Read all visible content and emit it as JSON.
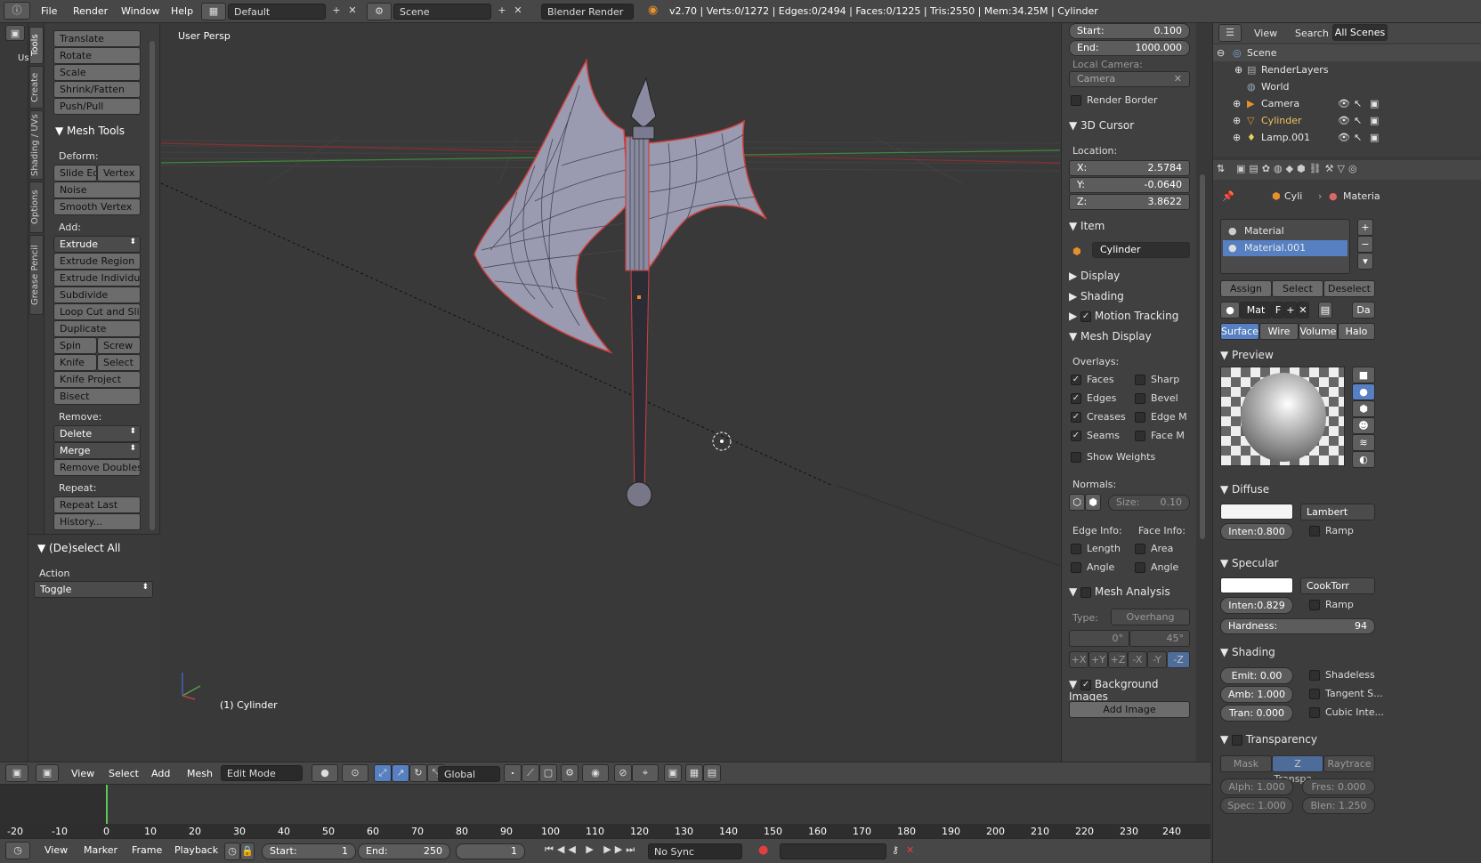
{
  "topbar": {
    "menus": [
      "File",
      "Render",
      "Window",
      "Help"
    ],
    "screen_layout": "Default",
    "scene": "Scene",
    "render_engine": "Blender Render",
    "stats": "v2.70 | Verts:0/1272 | Edges:0/2494 | Faces:0/1225 | Tris:2550 | Mem:34.25M | Cylinder"
  },
  "left_tabs": [
    "Tools",
    "Create",
    "Shading / UVs",
    "Options",
    "Grease Pencil"
  ],
  "toolshelf": {
    "transform_buttons": [
      "Translate",
      "Rotate",
      "Scale",
      "Shrink/Fatten",
      "Push/Pull"
    ],
    "mesh_tools_title": "Mesh Tools",
    "deform_label": "Deform:",
    "slide_edge": "Slide Ed",
    "vertex": "Vertex",
    "noise": "Noise",
    "smooth_vertex": "Smooth Vertex",
    "add_label": "Add:",
    "extrude": "Extrude",
    "extrude_region": "Extrude Region",
    "extrude_individual": "Extrude Individual",
    "subdivide": "Subdivide",
    "loop_cut": "Loop Cut and Slide",
    "duplicate": "Duplicate",
    "spin": "Spin",
    "screw": "Screw",
    "knife": "Knife",
    "select": "Select",
    "knife_project": "Knife Project",
    "bisect": "Bisect",
    "remove_label": "Remove:",
    "delete": "Delete",
    "merge": "Merge",
    "remove_doubles": "Remove Doubles",
    "repeat_label": "Repeat:",
    "repeat_last": "Repeat Last",
    "history": "History...",
    "deselect_title": "(De)select All",
    "action_label": "Action",
    "action_value": "Toggle"
  },
  "viewport": {
    "view_name": "User Persp",
    "object_label": "(1) Cylinder"
  },
  "npanel": {
    "start_label": "Start:",
    "start_value": "0.100",
    "end_label": "End:",
    "end_value": "1000.000",
    "local_camera": "Local Camera:",
    "camera": "Camera",
    "render_border": "Render Border",
    "cursor_title": "3D Cursor",
    "location": "Location:",
    "x_label": "X:",
    "x_value": "2.5784",
    "y_label": "Y:",
    "y_value": "-0.0640",
    "z_label": "Z:",
    "z_value": "3.8622",
    "item_title": "Item",
    "item_name": "Cylinder",
    "display": "Display",
    "shading": "Shading",
    "motion_tracking": "Motion Tracking",
    "mesh_display": "Mesh Display",
    "overlays": "Overlays:",
    "faces": "Faces",
    "sharp": "Sharp",
    "edges": "Edges",
    "bevel": "Bevel",
    "creases": "Creases",
    "edge_m": "Edge M",
    "seams": "Seams",
    "face_m": "Face M",
    "show_weights": "Show Weights",
    "normals": "Normals:",
    "normal_size": "Size:",
    "normal_size_value": "0.10",
    "edge_info": "Edge Info:",
    "face_info": "Face Info:",
    "length": "Length",
    "area": "Area",
    "angle1": "Angle",
    "angle2": "Angle",
    "mesh_analysis": "Mesh Analysis",
    "type_label": "Type:",
    "type_value": "Overhang",
    "range_min": "0°",
    "range_max": "45°",
    "axes": [
      "+X",
      "+Y",
      "+Z",
      "-X",
      "-Y",
      "-Z"
    ],
    "background_images": "Background Images",
    "add_image": "Add Image"
  },
  "outliner": {
    "view": "View",
    "search": "Search",
    "all_scenes": "All Scenes",
    "items": [
      "Scene",
      "RenderLayers",
      "World",
      "Camera",
      "Cylinder",
      "Lamp.001"
    ]
  },
  "properties": {
    "breadcrumb_obj": "Cyli",
    "breadcrumb_mat": "Materia",
    "materials": [
      "Material",
      "Material.001"
    ],
    "assign": "Assign",
    "select": "Select",
    "deselect": "Deselect",
    "mat_name": "Mat",
    "mat_f": "F",
    "mat_data": "Da",
    "tabs": [
      "Surface",
      "Wire",
      "Volume",
      "Halo"
    ],
    "preview": "Preview",
    "diffuse": "Diffuse",
    "diffuse_shader": "Lambert",
    "diffuse_intensity": "Inten:0.800",
    "ramp": "Ramp",
    "specular": "Specular",
    "specular_shader": "CookTorr",
    "specular_intensity": "Inten:0.829",
    "hardness_label": "Hardness:",
    "hardness_value": "94",
    "shading": "Shading",
    "emit": "Emit:  0.00",
    "amb": "Amb: 1.000",
    "tran": "Tran: 0.000",
    "shadeless": "Shadeless",
    "tangent": "Tangent S...",
    "cubic": "Cubic Inte...",
    "transparency": "Transparency",
    "transp_tabs": [
      "Mask",
      "Z Transpa...",
      "Raytrace"
    ],
    "alpha": "Alph: 1.000",
    "fresnel": "Fres: 0.000",
    "spec": "Spec: 1.000",
    "blend": "Blen: 1.250"
  },
  "vpheader": {
    "menus": [
      "View",
      "Select",
      "Add",
      "Mesh"
    ],
    "mode": "Edit Mode",
    "orientation": "Global"
  },
  "timeline": {
    "ticks": [
      "-20",
      "-10",
      "0",
      "10",
      "20",
      "30",
      "40",
      "50",
      "60",
      "70",
      "80",
      "90",
      "100",
      "110",
      "120",
      "130",
      "140",
      "150",
      "160",
      "170",
      "180",
      "190",
      "200",
      "210",
      "220",
      "230",
      "240"
    ],
    "current_frame_marker": 0
  },
  "timeheader": {
    "menus": [
      "View",
      "Marker",
      "Frame",
      "Playback"
    ],
    "start_label": "Start:",
    "start_value": "1",
    "end_label": "End:",
    "end_value": "250",
    "current": "1",
    "sync": "No Sync"
  },
  "colors": {
    "selection_blue": "#5680c2",
    "edit_outline": "#d04040",
    "x_axis": "#8b2e2e",
    "y_axis": "#3a8a3a"
  }
}
